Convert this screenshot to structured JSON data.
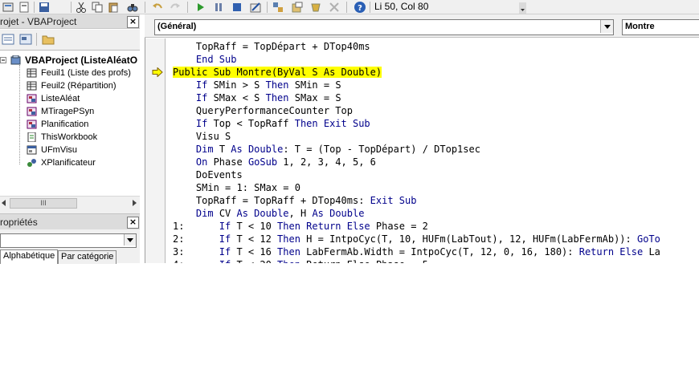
{
  "toolbar": {
    "cursor_position": "Li 50, Col 80"
  },
  "project": {
    "title": "rojet - VBAProject",
    "close_label": "×",
    "tree": [
      {
        "label": "VBAProject (ListeAléatO",
        "icon": "vba-project-icon",
        "bold": true
      },
      {
        "label": "Feuil1 (Liste des profs)",
        "icon": "worksheet-icon"
      },
      {
        "label": "Feuil2 (Répartition)",
        "icon": "worksheet-icon"
      },
      {
        "label": "ListeAléat",
        "icon": "module-icon"
      },
      {
        "label": "MTiragePSyn",
        "icon": "module-icon"
      },
      {
        "label": "Planification",
        "icon": "module-icon"
      },
      {
        "label": "ThisWorkbook",
        "icon": "workbook-icon"
      },
      {
        "label": "UFmVisu",
        "icon": "userform-icon"
      },
      {
        "label": "XPlanificateur",
        "icon": "class-module-icon"
      }
    ],
    "scroll_grip": "III"
  },
  "properties": {
    "title": "ropriétés",
    "close_label": "×",
    "tab_alpha": "Alphabétique",
    "tab_category": "Par catégorie"
  },
  "code_window": {
    "object_combo": "(Général)",
    "procedure_combo": "Montre"
  },
  "code_lines": [
    [
      [
        "    TopRaff = TopDépart + DTop40ms",
        ""
      ]
    ],
    [
      [
        "    ",
        ""
      ],
      [
        "End Sub",
        "kw"
      ]
    ],
    [
      [
        "Public Sub Montre(ByVal S As Double)",
        "hl"
      ]
    ],
    [
      [
        "    ",
        ""
      ],
      [
        "If",
        "kw"
      ],
      [
        " SMin > S ",
        ""
      ],
      [
        "Then",
        "kw"
      ],
      [
        " SMin = S",
        ""
      ]
    ],
    [
      [
        "    ",
        ""
      ],
      [
        "If",
        "kw"
      ],
      [
        " SMax < S ",
        ""
      ],
      [
        "Then",
        "kw"
      ],
      [
        " SMax = S",
        ""
      ]
    ],
    [
      [
        "    QueryPerformanceCounter Top",
        ""
      ]
    ],
    [
      [
        "    ",
        ""
      ],
      [
        "If",
        "kw"
      ],
      [
        " Top < TopRaff ",
        ""
      ],
      [
        "Then Exit Sub",
        "kw"
      ]
    ],
    [
      [
        "    Visu S",
        ""
      ]
    ],
    [
      [
        "    ",
        ""
      ],
      [
        "Dim",
        "kw"
      ],
      [
        " T ",
        ""
      ],
      [
        "As Double",
        "kw"
      ],
      [
        ": T = (Top - TopDépart) / DTop1sec",
        ""
      ]
    ],
    [
      [
        "    ",
        ""
      ],
      [
        "On",
        "kw"
      ],
      [
        " Phase ",
        ""
      ],
      [
        "GoSub",
        "kw"
      ],
      [
        " 1, 2, 3, 4, 5, 6",
        ""
      ]
    ],
    [
      [
        "    DoEvents",
        ""
      ]
    ],
    [
      [
        "    SMin = 1: SMax = 0",
        ""
      ]
    ],
    [
      [
        "    TopRaff = TopRaff + DTop40ms: ",
        ""
      ],
      [
        "Exit Sub",
        "kw"
      ]
    ],
    [
      [
        "    ",
        ""
      ],
      [
        "Dim",
        "kw"
      ],
      [
        " CV ",
        ""
      ],
      [
        "As Double",
        "kw"
      ],
      [
        ", H ",
        ""
      ],
      [
        "As Double",
        "kw"
      ]
    ],
    [
      [
        "1:      ",
        ""
      ],
      [
        "If",
        "kw"
      ],
      [
        " T < 10 ",
        ""
      ],
      [
        "Then Return Else",
        "kw"
      ],
      [
        " Phase = 2",
        ""
      ]
    ],
    [
      [
        "2:      ",
        ""
      ],
      [
        "If",
        "kw"
      ],
      [
        " T < 12 ",
        ""
      ],
      [
        "Then",
        "kw"
      ],
      [
        " H = IntpoCyc(T, 10, HUFm(LabTout), 12, HUFm(LabFermAb)): ",
        ""
      ],
      [
        "GoTo",
        "kw"
      ]
    ],
    [
      [
        "3:      ",
        ""
      ],
      [
        "If",
        "kw"
      ],
      [
        " T < 16 ",
        ""
      ],
      [
        "Then",
        "kw"
      ],
      [
        " LabFermAb.Width = IntpoCyc(T, 12, 0, 16, 180): ",
        ""
      ],
      [
        "Return Else",
        "kw"
      ],
      [
        " La",
        ""
      ]
    ],
    [
      [
        "4:      ",
        ""
      ],
      [
        "If",
        "kw"
      ],
      [
        " T < 20 ",
        ""
      ],
      [
        "Then",
        "kw"
      ],
      [
        " Return Else Phase = 5",
        ""
      ]
    ]
  ]
}
